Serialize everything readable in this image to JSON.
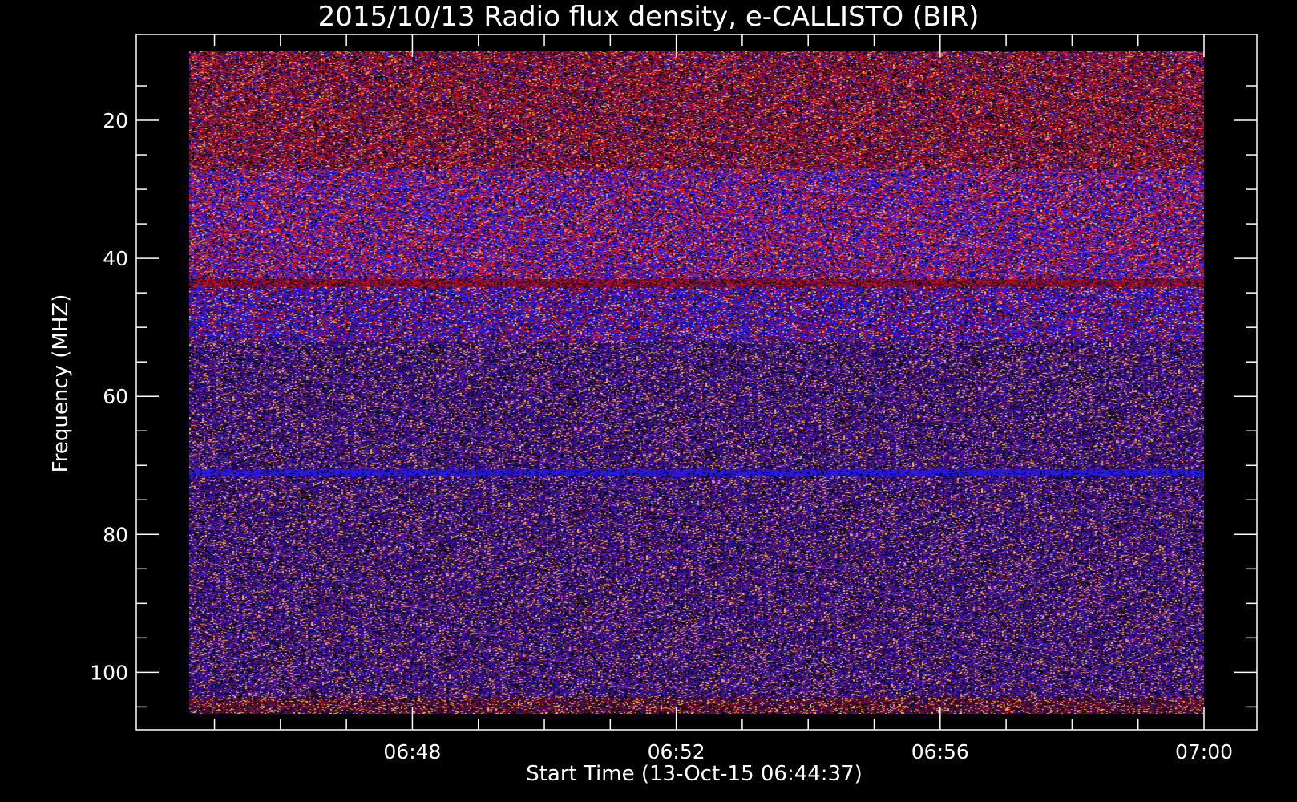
{
  "chart_data": {
    "type": "heatmap",
    "title": "2015/10/13  Radio flux density, e-CALLISTO (BIR)",
    "xlabel": "Start Time (13-Oct-15 06:44:37)",
    "ylabel": "Frequency (MHZ)",
    "x_ticks": [
      "06:48",
      "06:52",
      "06:56",
      "07:00"
    ],
    "y_ticks": [
      "20",
      "40",
      "60",
      "80",
      "100"
    ],
    "x_range_minutes": [
      "06:44:37",
      "07:00:00"
    ],
    "y_range_mhz": [
      10,
      106
    ],
    "y_axis_inverted": true,
    "colormap": [
      "#000000",
      "#2a0a6e",
      "#3b12c8",
      "#1a1aff",
      "#c01010",
      "#ff2a1a",
      "#ff8a40",
      "#ffd060"
    ],
    "bands": [
      {
        "from_mhz": 10,
        "to_mhz": 27,
        "tone": "red-dominant"
      },
      {
        "from_mhz": 27,
        "to_mhz": 52,
        "tone": "blue-red mixed, bright"
      },
      {
        "from_mhz": 52,
        "to_mhz": 106,
        "tone": "purple noise"
      }
    ]
  }
}
